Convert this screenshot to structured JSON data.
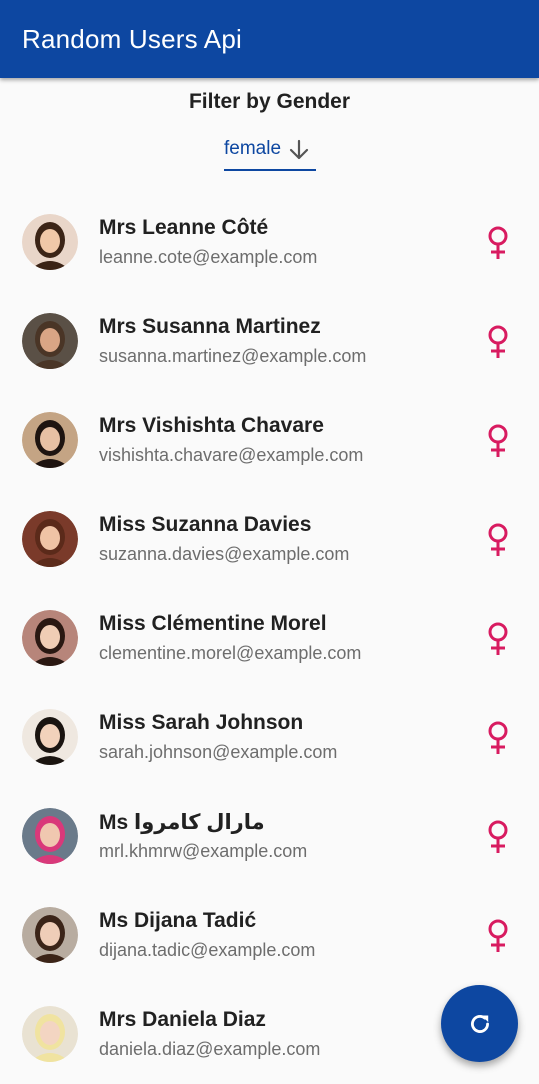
{
  "appbar": {
    "title": "Random Users Api"
  },
  "filter": {
    "title": "Filter by Gender",
    "selected": "female"
  },
  "colors": {
    "primary": "#0d47a1",
    "female": "#d81b60"
  },
  "users": [
    {
      "name": "Mrs Leanne Côté",
      "email": "leanne.cote@example.com",
      "gender_icon": "female-icon",
      "avatar_bg": "#e9d6c9",
      "hair": "#3b2416",
      "skin": "#f0c8a8"
    },
    {
      "name": "Mrs Susanna Martinez",
      "email": "susanna.martinez@example.com",
      "gender_icon": "female-icon",
      "avatar_bg": "#5a5046",
      "hair": "#4a3526",
      "skin": "#d9a585"
    },
    {
      "name": "Mrs Vishishta Chavare",
      "email": "vishishta.chavare@example.com",
      "gender_icon": "female-icon",
      "avatar_bg": "#c4a484",
      "hair": "#1e1410",
      "skin": "#e7c0a4"
    },
    {
      "name": "Miss Suzanna Davies",
      "email": "suzanna.davies@example.com",
      "gender_icon": "female-icon",
      "avatar_bg": "#7a3a2a",
      "hair": "#5b2a1a",
      "skin": "#efc3a5"
    },
    {
      "name": "Miss Clémentine Morel",
      "email": "clementine.morel@example.com",
      "gender_icon": "female-icon",
      "avatar_bg": "#b7857a",
      "hair": "#2a1812",
      "skin": "#f0cdb5"
    },
    {
      "name": "Miss Sarah Johnson",
      "email": "sarah.johnson@example.com",
      "gender_icon": "female-icon",
      "avatar_bg": "#efe8e0",
      "hair": "#1a1410",
      "skin": "#f2d2bb"
    },
    {
      "name": "Ms مارال کامروا",
      "email": "mrl.khmrw@example.com",
      "gender_icon": "female-icon",
      "avatar_bg": "#6a7a8a",
      "hair": "#d9397a",
      "skin": "#f0c8b0"
    },
    {
      "name": "Ms Dijana Tadić",
      "email": "dijana.tadic@example.com",
      "gender_icon": "female-icon",
      "avatar_bg": "#b8aca0",
      "hair": "#3b2418",
      "skin": "#efcdb8"
    },
    {
      "name": "Mrs Daniela Diaz",
      "email": "daniela.diaz@example.com",
      "gender_icon": "female-icon",
      "avatar_bg": "#e9e2d2",
      "hair": "#f0e3a0",
      "skin": "#f3d5c2"
    }
  ],
  "fab": {
    "icon": "refresh-icon"
  }
}
